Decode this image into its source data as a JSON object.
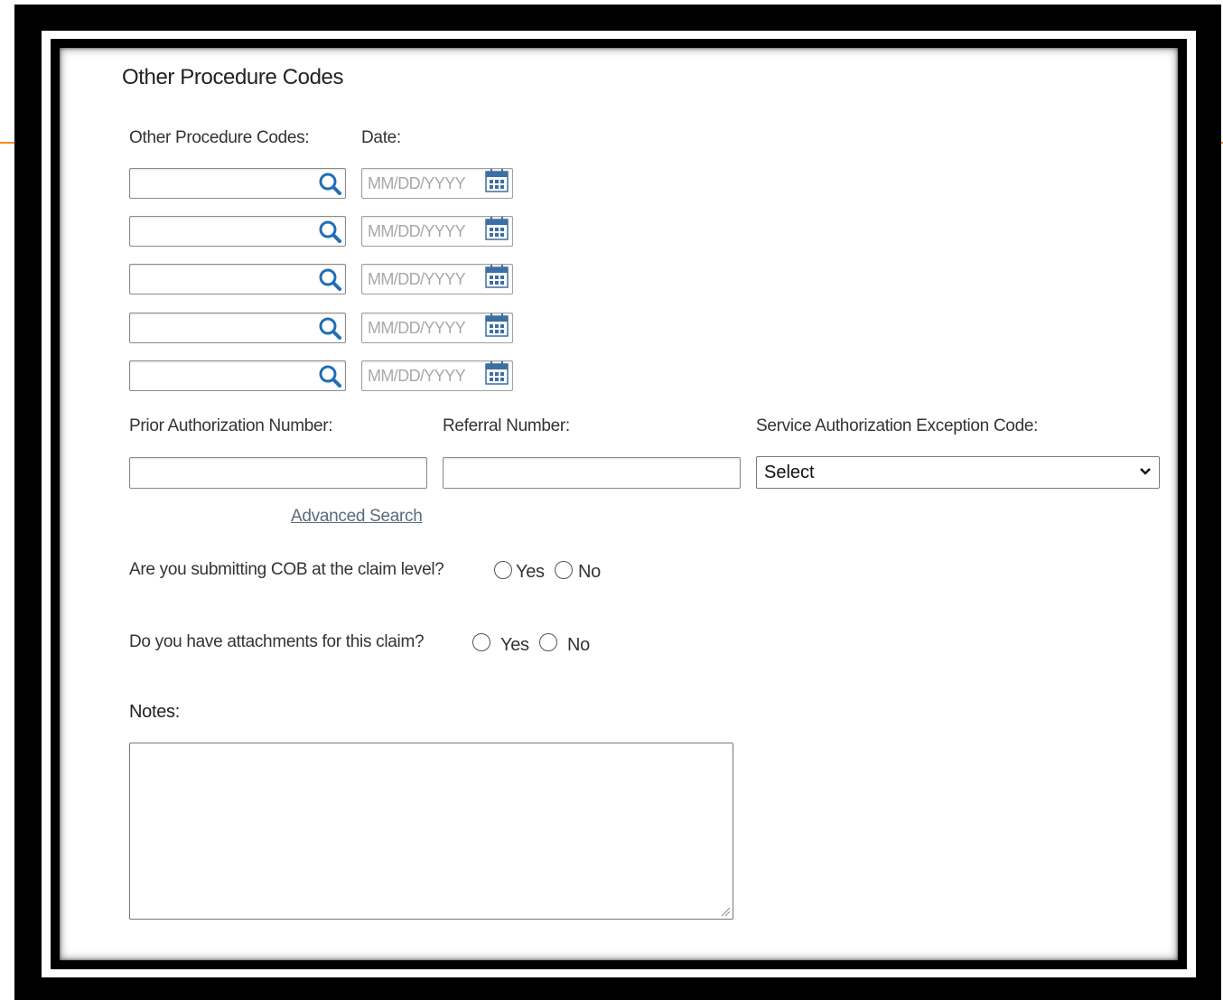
{
  "section": {
    "title": "Other Procedure Codes"
  },
  "procedure_codes": {
    "code_label": "Other Procedure Codes:",
    "date_label": "Date:",
    "rows": [
      {
        "code_value": "",
        "date_placeholder": "MM/DD/YYYY"
      },
      {
        "code_value": "",
        "date_placeholder": "MM/DD/YYYY"
      },
      {
        "code_value": "",
        "date_placeholder": "MM/DD/YYYY"
      },
      {
        "code_value": "",
        "date_placeholder": "MM/DD/YYYY"
      },
      {
        "code_value": "",
        "date_placeholder": "MM/DD/YYYY"
      }
    ]
  },
  "authorization": {
    "prior_auth_label": "Prior Authorization Number:",
    "prior_auth_value": "",
    "referral_label": "Referral Number:",
    "referral_value": "",
    "exception_label": "Service Authorization Exception Code:",
    "exception_selected": "Select",
    "advanced_search": "Advanced Search"
  },
  "cob_question": {
    "text": "Are you submitting COB at the claim level?",
    "yes": "Yes",
    "no": "No",
    "selected": null
  },
  "attachments_question": {
    "text": "Do you have attachments for this claim?",
    "yes": "Yes",
    "no": "No",
    "selected": null
  },
  "notes": {
    "label": "Notes:",
    "value": ""
  },
  "colors": {
    "accent": "#f28c1e",
    "icon_blue": "#1f6fb5",
    "frame": "#000000"
  }
}
